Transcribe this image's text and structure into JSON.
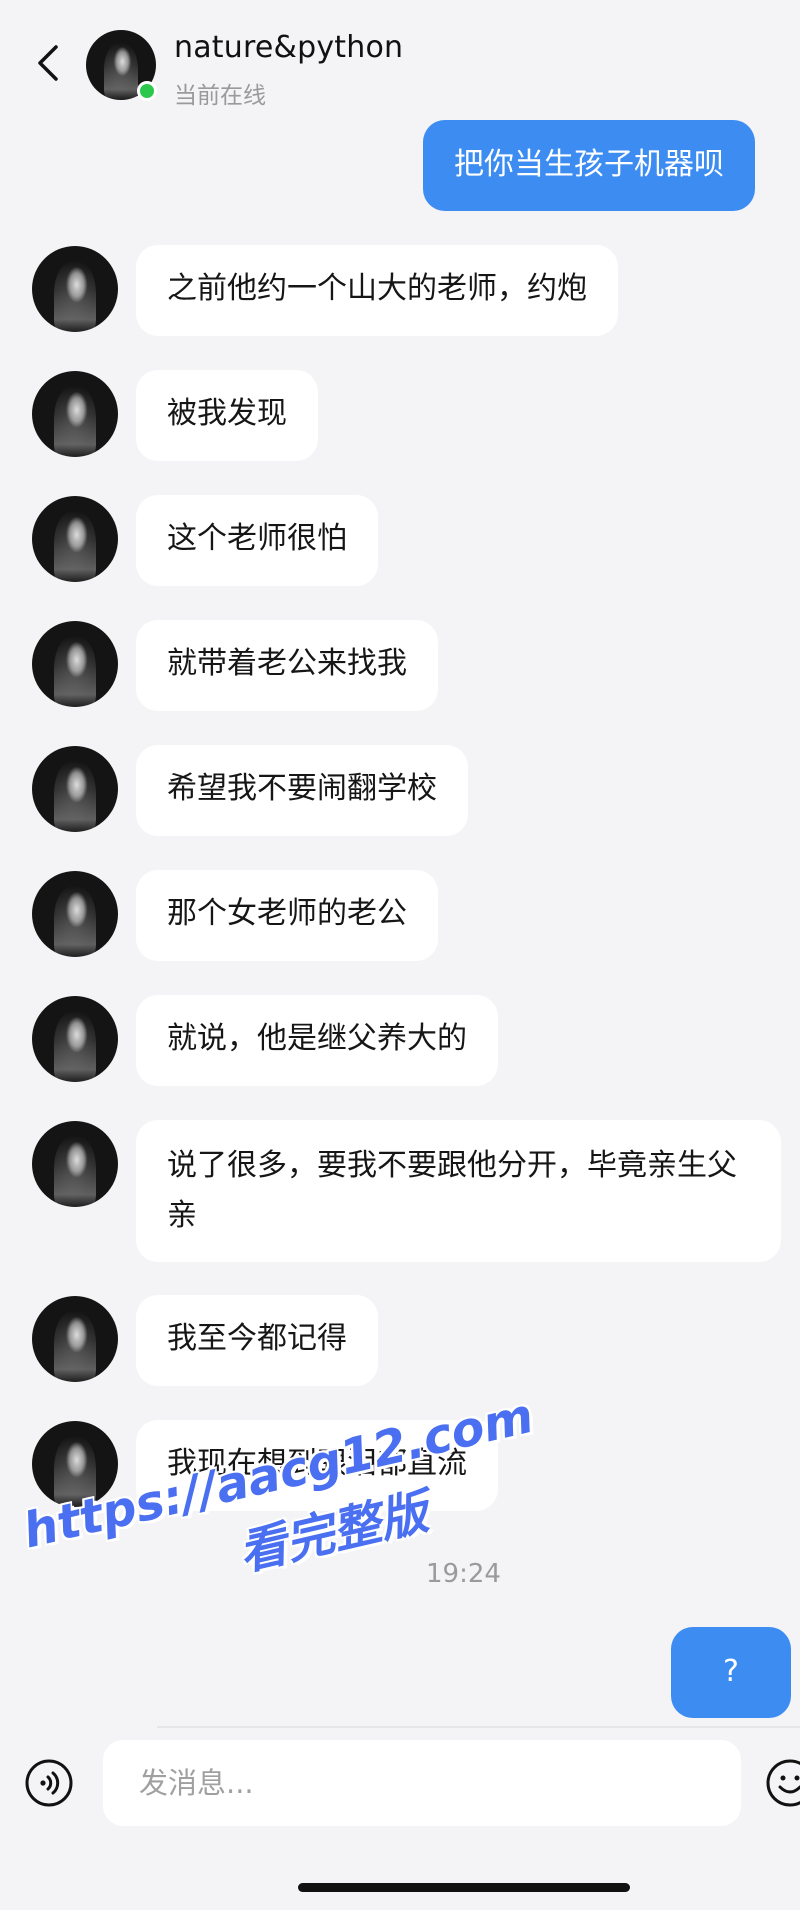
{
  "header": {
    "contact_name": "nature&python",
    "status": "当前在线"
  },
  "messages": [
    {
      "side": "sent",
      "text": "把你当生孩子机器呗"
    },
    {
      "side": "received",
      "text": "之前他约一个山大的老师，约炮"
    },
    {
      "side": "received",
      "text": "被我发现"
    },
    {
      "side": "received",
      "text": "这个老师很怕"
    },
    {
      "side": "received",
      "text": "就带着老公来找我"
    },
    {
      "side": "received",
      "text": "希望我不要闹翻学校"
    },
    {
      "side": "received",
      "text": "那个女老师的老公"
    },
    {
      "side": "received",
      "text": "就说，他是继父养大的"
    },
    {
      "side": "received",
      "text": "说了很多，要我不要跟他分开，毕竟亲生父亲"
    },
    {
      "side": "received",
      "text": "我至今都记得"
    },
    {
      "side": "received",
      "text": "我现在想到眼泪都直流"
    },
    {
      "side": "sent",
      "text": "?"
    }
  ],
  "timestamp": "19:24",
  "watermark": {
    "url": "https://aacg12.com",
    "text": "看完整版"
  },
  "input": {
    "placeholder": "发消息..."
  },
  "colors": {
    "sent_bubble": "#3d8cf2",
    "received_bubble": "#ffffff",
    "background": "#f4f4f6",
    "online_dot": "#2bc84d",
    "watermark": "#4a6ff0"
  },
  "icons": {
    "back": "chevron-left-icon",
    "voice": "voice-icon",
    "emoji": "emoji-icon"
  }
}
